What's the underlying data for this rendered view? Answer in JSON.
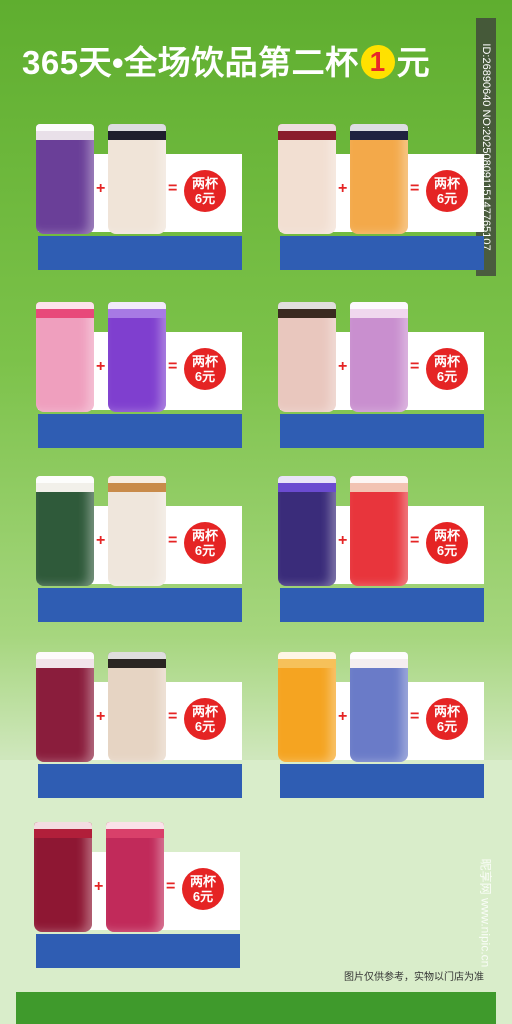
{
  "title": {
    "prefix": "365天•全场饮品第二杯",
    "highlight": "1",
    "suffix": "元"
  },
  "side_id": "ID:26890640 NO:20250809115147765107",
  "footnote": "图片仅供参考，实物以门店为准",
  "watermark": "昵享网 www.nipic.cn",
  "badge": {
    "line1": "两杯",
    "line2": "6元"
  },
  "symbols": {
    "plus": "+",
    "equals": "="
  },
  "cards": [
    {
      "cup1": {
        "body": "#6a3f98",
        "top": "#e9e0e9"
      },
      "cup2": {
        "body": "#f0e4d8",
        "top": "#1f1f2e"
      }
    },
    {
      "cup1": {
        "body": "#f2dfd2",
        "top": "#8a1d2c"
      },
      "cup2": {
        "body": "#f3a94a",
        "top": "#1f2240"
      }
    },
    {
      "cup1": {
        "body": "#ef9fbe",
        "top": "#e8497a"
      },
      "cup2": {
        "body": "#7f3fcf",
        "top": "#a77ae4"
      }
    },
    {
      "cup1": {
        "body": "#e9c7be",
        "top": "#3a2a20"
      },
      "cup2": {
        "body": "#c98fcf",
        "top": "#f0d7ee"
      }
    },
    {
      "cup1": {
        "body": "#2f5a3a",
        "top": "#f2f0ea"
      },
      "cup2": {
        "body": "#efe6dc",
        "top": "#c98b4a"
      }
    },
    {
      "cup1": {
        "body": "#3a2c7a",
        "top": "#6b4bd0"
      },
      "cup2": {
        "body": "#e8353c",
        "top": "#f2c3b2"
      }
    },
    {
      "cup1": {
        "body": "#8a1d3c",
        "top": "#f1e4ea"
      },
      "cup2": {
        "body": "#e6d4c3",
        "top": "#2a2522"
      }
    },
    {
      "cup1": {
        "body": "#f5a421",
        "top": "#f6c15a"
      },
      "cup2": {
        "body": "#6a7bc8",
        "top": "#f4eef0"
      }
    },
    {
      "cup1": {
        "body": "#8e1733",
        "top": "#b11f3a"
      },
      "cup2": {
        "body": "#c12a5a",
        "top": "#d9406a"
      }
    }
  ]
}
